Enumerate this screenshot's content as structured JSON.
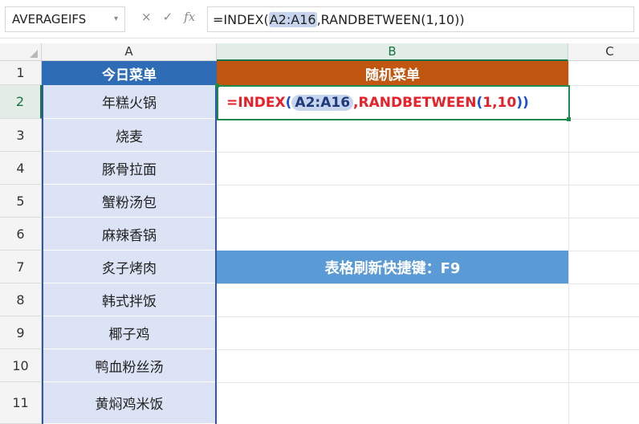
{
  "formula_bar": {
    "name_box": "AVERAGEIFS",
    "cancel_glyph": "×",
    "enter_glyph": "✓",
    "fx_glyph": "fx",
    "formula_prefix": "=INDEX(",
    "formula_ref": "A2:A16",
    "formula_suffix": ",RANDBETWEEN(1,10))"
  },
  "columns": [
    "A",
    "B",
    "C"
  ],
  "rows": [
    "1",
    "2",
    "3",
    "4",
    "5",
    "6",
    "7",
    "8",
    "9",
    "10",
    "11"
  ],
  "sheet": {
    "a_header": "今日菜单",
    "b_header": "随机菜单",
    "menu": [
      "年糕火锅",
      "烧麦",
      "豚骨拉面",
      "蟹粉汤包",
      "麻辣香锅",
      "炙子烤肉",
      "韩式拌饭",
      "椰子鸡",
      "鸭血粉丝汤",
      "黄焖鸡米饭"
    ],
    "b2_formula": {
      "eq_index": "=INDEX",
      "open1": "(",
      "ref": "A2:A16",
      "comma": ",",
      "randfn": "RANDBETWEEN",
      "open2": "(",
      "args": "1,10",
      "close2": ")",
      "close1": ")"
    },
    "b7_note": "表格刷新快捷键：F9"
  },
  "colors": {
    "a_header_bg": "#2e6db5",
    "b_header_bg": "#c0560f",
    "a_data_bg": "#dbe3f4",
    "note_bg": "#5b9bd5",
    "formula_text": "#e8202a",
    "active_cell_border": "#1e8a4c"
  }
}
